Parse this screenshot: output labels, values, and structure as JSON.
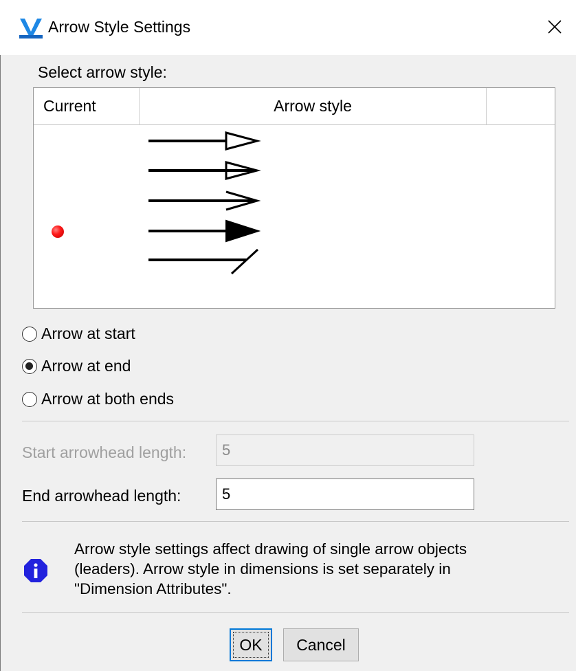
{
  "window": {
    "title": "Arrow Style Settings",
    "icon": "vertex-app-icon",
    "close_icon": "close-icon"
  },
  "select_label": "Select arrow style:",
  "table": {
    "columns": [
      "Current",
      "Arrow style",
      ""
    ],
    "arrow_styles": [
      {
        "style": "open-triangle-short",
        "current": false
      },
      {
        "style": "open-triangle-long",
        "current": false
      },
      {
        "style": "open-chevron",
        "current": false
      },
      {
        "style": "filled-triangle",
        "current": true
      },
      {
        "style": "slash-tick",
        "current": false
      }
    ],
    "current_marker_color": "#e00000"
  },
  "arrow_position": {
    "options": [
      "Arrow at start",
      "Arrow at end",
      "Arrow at both ends"
    ],
    "selected": "Arrow at end"
  },
  "start_length": {
    "label": "Start arrowhead length:",
    "value": "5",
    "enabled": false
  },
  "end_length": {
    "label": "End arrowhead length:",
    "value": "5",
    "enabled": true
  },
  "info": {
    "icon": "info-icon",
    "line1": "Arrow style settings affect drawing of single arrow objects",
    "line2": "(leaders). Arrow style in dimensions is set separately in",
    "line3": "\"Dimension Attributes\"."
  },
  "buttons": {
    "ok": "OK",
    "cancel": "Cancel"
  },
  "colors": {
    "accent": "#0078d7",
    "info_blue": "#2222dd"
  }
}
